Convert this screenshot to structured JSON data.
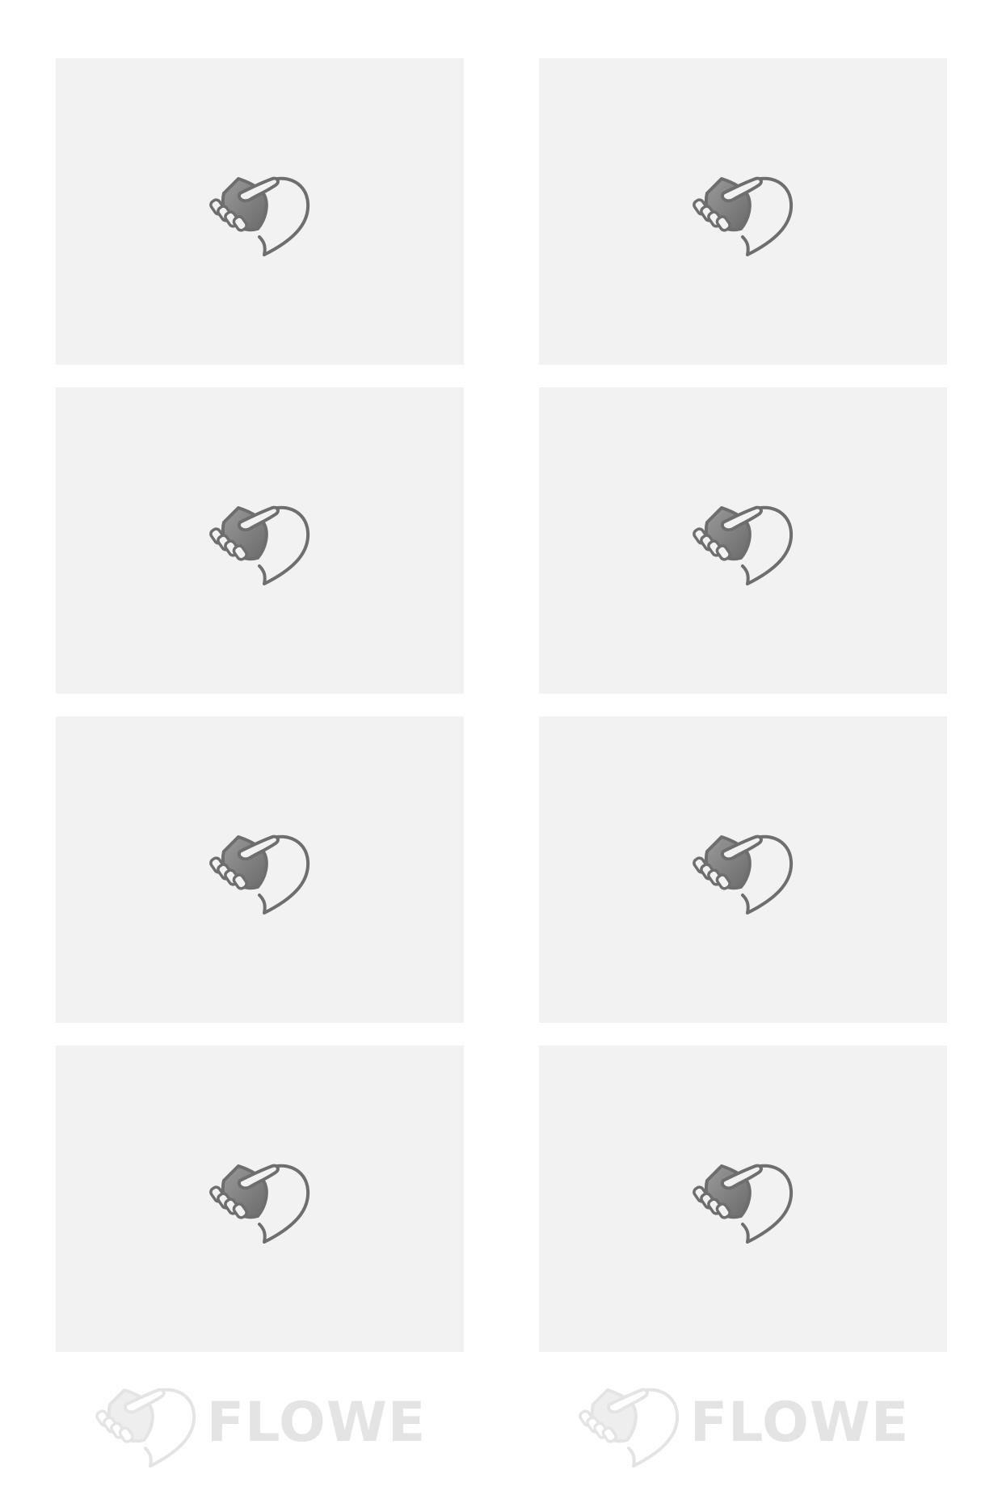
{
  "tiles": [
    {
      "icon": "handshake-heart-icon"
    },
    {
      "icon": "handshake-heart-icon"
    },
    {
      "icon": "handshake-heart-icon"
    },
    {
      "icon": "handshake-heart-icon"
    },
    {
      "icon": "handshake-heart-icon"
    },
    {
      "icon": "handshake-heart-icon"
    },
    {
      "icon": "handshake-heart-icon"
    },
    {
      "icon": "handshake-heart-icon"
    }
  ],
  "brand": {
    "name": "FLOWE",
    "logo_icon": "handshake-heart-logo-icon"
  },
  "colors": {
    "background": "#ffffff",
    "tile_background": "#f2f2f2",
    "icon_stroke": "#6e6e6e",
    "icon_fill_dark": "#7a7a7a",
    "brand_color": "#e4e4e4"
  }
}
